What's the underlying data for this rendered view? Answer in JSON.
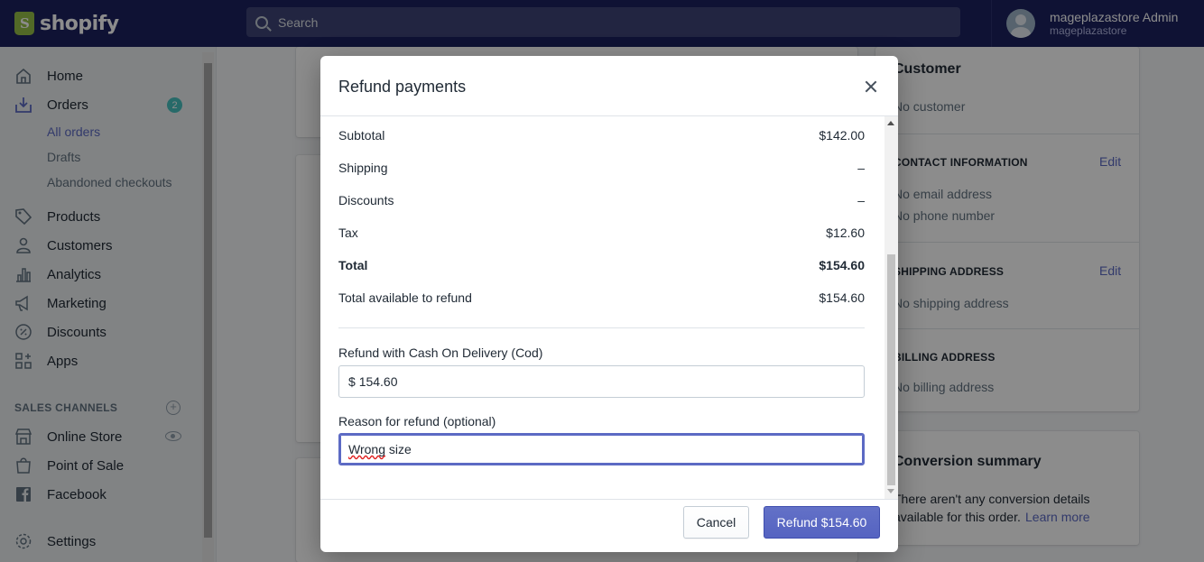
{
  "topbar": {
    "brand": "shopify",
    "search_placeholder": "Search",
    "user_name": "mageplazastore Admin",
    "user_store": "mageplazastore"
  },
  "sidebar": {
    "home": "Home",
    "orders": "Orders",
    "orders_badge": "2",
    "all_orders": "All orders",
    "drafts": "Drafts",
    "abandoned": "Abandoned checkouts",
    "products": "Products",
    "customers": "Customers",
    "analytics": "Analytics",
    "marketing": "Marketing",
    "discounts": "Discounts",
    "apps": "Apps",
    "sales_channels": "SALES CHANNELS",
    "online_store": "Online Store",
    "point_of_sale": "Point of Sale",
    "facebook": "Facebook",
    "settings": "Settings"
  },
  "right_panel": {
    "customer_title": "Customer",
    "no_customer": "No customer",
    "contact_label": "CONTACT INFORMATION",
    "contact_edit": "Edit",
    "no_email": "No email address",
    "no_phone": "No phone number",
    "shipping_label": "SHIPPING ADDRESS",
    "shipping_edit": "Edit",
    "no_shipping": "No shipping address",
    "billing_label": "BILLING ADDRESS",
    "no_billing": "No billing address",
    "conversion_title": "Conversion summary",
    "conversion_text_1": "There aren't any conversion details",
    "conversion_text_2": "available for this order.",
    "learn_more": "Learn more"
  },
  "modal": {
    "title": "Refund payments",
    "rows": [
      {
        "label": "Subtotal",
        "value": "$142.00"
      },
      {
        "label": "Shipping",
        "value": "–"
      },
      {
        "label": "Discounts",
        "value": "–"
      },
      {
        "label": "Tax",
        "value": "$12.60"
      },
      {
        "label": "Total",
        "value": "$154.60"
      },
      {
        "label": "Total available to refund",
        "value": "$154.60"
      }
    ],
    "refund_label": "Refund with Cash On Delivery (Cod)",
    "refund_currency": "$",
    "refund_amount": "154.60",
    "reason_label": "Reason for refund (optional)",
    "reason_word1": "Wrong",
    "reason_word2": " size",
    "cancel": "Cancel",
    "refund_button": "Refund $154.60"
  }
}
